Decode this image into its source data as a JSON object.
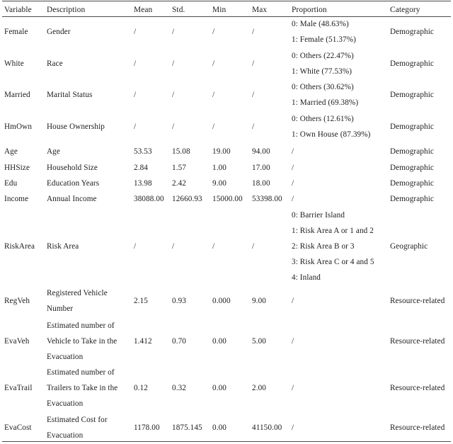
{
  "table": {
    "columns": [
      {
        "key": "variable",
        "label": "Variable"
      },
      {
        "key": "description",
        "label": "Description"
      },
      {
        "key": "mean",
        "label": "Mean"
      },
      {
        "key": "std",
        "label": "Std."
      },
      {
        "key": "min",
        "label": "Min"
      },
      {
        "key": "max",
        "label": "Max"
      },
      {
        "key": "proportion",
        "label": "Proportion"
      },
      {
        "key": "category",
        "label": "Category"
      }
    ],
    "rows": [
      {
        "variable": "Female",
        "description": [
          "Gender"
        ],
        "mean": "/",
        "std": "/",
        "min": "/",
        "max": "/",
        "proportion": [
          "0: Male (48.63%)",
          "1: Female (51.37%)"
        ],
        "category": "Demographic"
      },
      {
        "variable": "White",
        "description": [
          "Race"
        ],
        "mean": "/",
        "std": "/",
        "min": "/",
        "max": "/",
        "proportion": [
          "0: Others (22.47%)",
          "1: White (77.53%)"
        ],
        "category": "Demographic"
      },
      {
        "variable": "Married",
        "description": [
          "Marital Status"
        ],
        "mean": "/",
        "std": "/",
        "min": "/",
        "max": "/",
        "proportion": [
          "0: Others (30.62%)",
          "1: Married (69.38%)"
        ],
        "category": "Demographic"
      },
      {
        "variable": "HmOwn",
        "description": [
          "House Ownership"
        ],
        "mean": "/",
        "std": "/",
        "min": "/",
        "max": "/",
        "proportion": [
          "0: Others (12.61%)",
          "1: Own House (87.39%)"
        ],
        "category": "Demographic"
      },
      {
        "variable": "Age",
        "description": [
          "Age"
        ],
        "mean": "53.53",
        "std": "15.08",
        "min": "19.00",
        "max": "94.00",
        "proportion": [
          "/"
        ],
        "category": "Demographic"
      },
      {
        "variable": "HHSize",
        "description": [
          "Household Size"
        ],
        "mean": "2.84",
        "std": "1.57",
        "min": "1.00",
        "max": "17.00",
        "proportion": [
          "/"
        ],
        "category": "Demographic"
      },
      {
        "variable": "Edu",
        "description": [
          "Education Years"
        ],
        "mean": "13.98",
        "std": "2.42",
        "min": "9.00",
        "max": "18.00",
        "proportion": [
          "/"
        ],
        "category": "Demographic"
      },
      {
        "variable": "Income",
        "description": [
          "Annual Income"
        ],
        "mean": "38088.00",
        "std": "12660.93",
        "min": "15000.00",
        "max": "53398.00",
        "proportion": [
          "/"
        ],
        "category": "Demographic"
      },
      {
        "variable": "RiskArea",
        "description": [
          "Risk Area"
        ],
        "mean": "/",
        "std": "/",
        "min": "/",
        "max": "/",
        "proportion": [
          "0: Barrier Island",
          "1: Risk Area A or 1 and 2",
          "2: Risk Area B or 3",
          "3: Risk Area C or 4 and 5",
          "4: Inland"
        ],
        "category": "Geographic"
      },
      {
        "variable": "RegVeh",
        "description": [
          "Registered Vehicle",
          "Number"
        ],
        "mean": "2.15",
        "std": "0.93",
        "min": "0.000",
        "max": "9.00",
        "proportion": [
          "/"
        ],
        "category": "Resource-related"
      },
      {
        "variable": "EvaVeh",
        "description": [
          "Estimated number of",
          "Vehicle to Take in the",
          "Evacuation"
        ],
        "mean": "1.412",
        "std": "0.70",
        "min": "0.00",
        "max": "5.00",
        "proportion": [
          "/"
        ],
        "category": "Resource-related"
      },
      {
        "variable": "EvaTrail",
        "description": [
          "Estimated number of",
          "Trailers to Take in the",
          "Evacuation"
        ],
        "mean": "0.12",
        "std": "0.32",
        "min": "0.00",
        "max": "2.00",
        "proportion": [
          "/"
        ],
        "category": "Resource-related"
      },
      {
        "variable": "EvaCost",
        "description": [
          "Estimated Cost for",
          "Evacuation"
        ],
        "mean": "1178.00",
        "std": "1875.145",
        "min": "0.00",
        "max": "41150.00",
        "proportion": [
          "/"
        ],
        "category": "Resource-related"
      }
    ],
    "row_anchors": [
      45,
      90,
      134,
      179,
      214,
      237,
      259,
      281,
      348,
      425,
      482,
      548,
      604
    ],
    "header_baseline": 14,
    "line_height": 22,
    "colors": {
      "text": "#1c1c1c",
      "rule": "#4a4a4a",
      "background": "#ffffff"
    }
  }
}
